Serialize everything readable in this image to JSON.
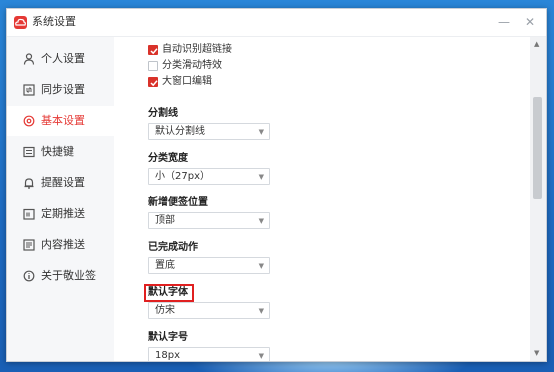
{
  "window": {
    "title": "系统设置",
    "minimize_glyph": "—",
    "close_glyph": "✕",
    "accent_color": "#e53935"
  },
  "sidebar": {
    "items": [
      {
        "label": "个人设置",
        "icon": "person-icon",
        "active": false
      },
      {
        "label": "同步设置",
        "icon": "sync-icon",
        "active": false
      },
      {
        "label": "基本设置",
        "icon": "settings-icon",
        "active": true
      },
      {
        "label": "快捷键",
        "icon": "keyboard-icon",
        "active": false
      },
      {
        "label": "提醒设置",
        "icon": "bell-icon",
        "active": false
      },
      {
        "label": "定期推送",
        "icon": "calendar-icon",
        "active": false
      },
      {
        "label": "内容推送",
        "icon": "document-icon",
        "active": false
      },
      {
        "label": "关于敬业签",
        "icon": "info-icon",
        "active": false
      }
    ]
  },
  "main": {
    "checkboxes": [
      {
        "label": "自动识别超链接",
        "checked": true
      },
      {
        "label": "分类滑动特效",
        "checked": false
      },
      {
        "label": "大窗口编辑",
        "checked": true
      }
    ],
    "settings": [
      {
        "label": "分割线",
        "value": "默认分割线"
      },
      {
        "label": "分类宽度",
        "value": "小（27px）"
      },
      {
        "label": "新增便签位置",
        "value": "顶部"
      },
      {
        "label": "已完成动作",
        "value": "置底"
      },
      {
        "label": "默认字体",
        "value": "仿宋"
      },
      {
        "label": "默认字号",
        "value": "18px"
      }
    ],
    "dropdown_arrow": "▼"
  },
  "scrollbar": {
    "up_glyph": "▲",
    "down_glyph": "▼"
  }
}
